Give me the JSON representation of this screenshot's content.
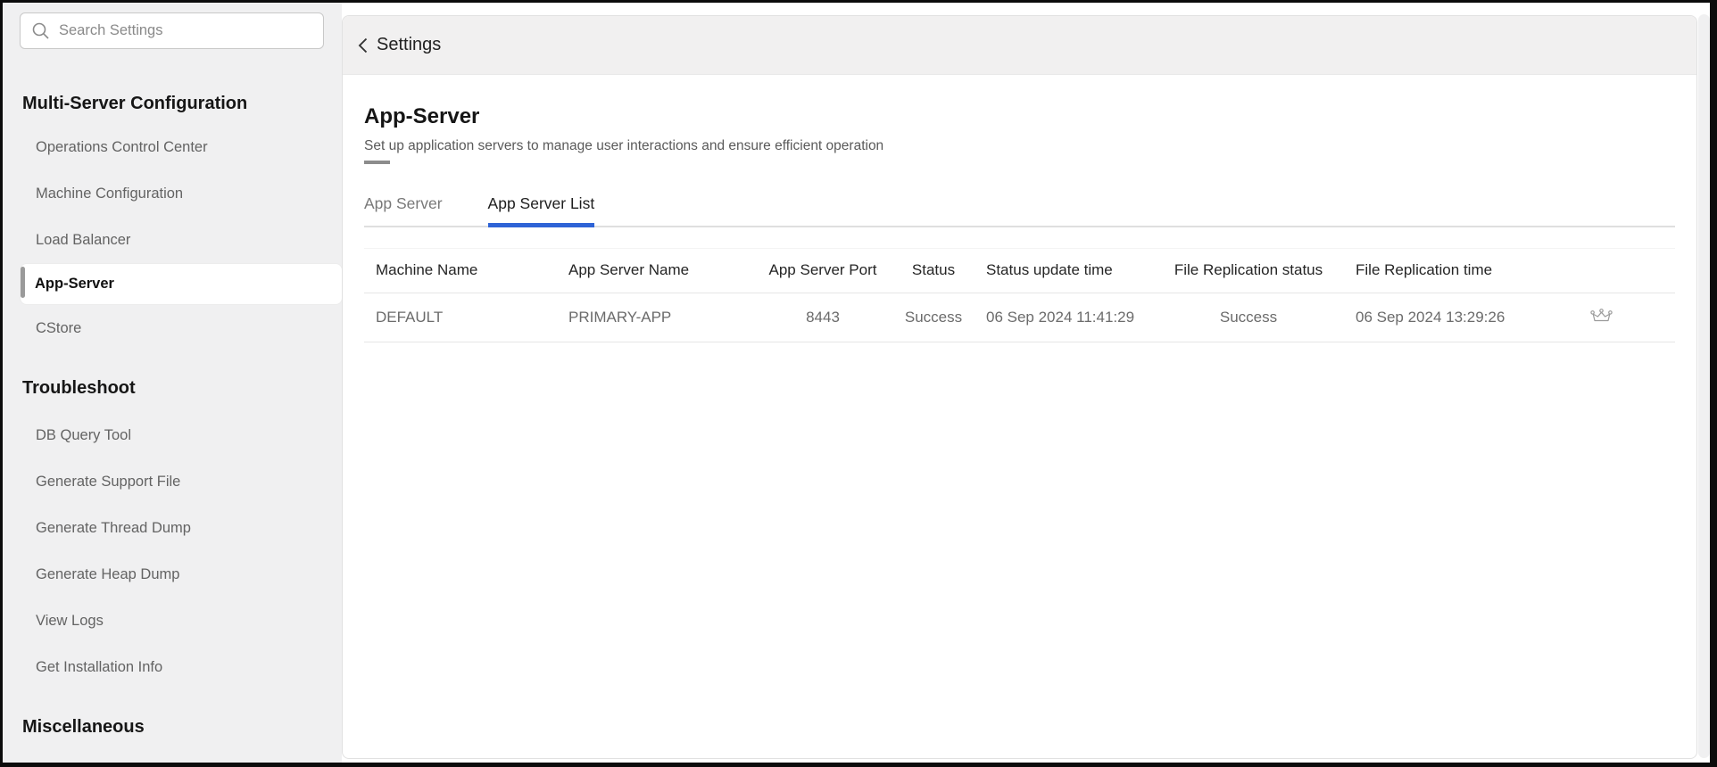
{
  "colors": {
    "accent_blue": "#2e63d6",
    "selected_item_accent": "#9a9a9a",
    "sidebar_background": "#f0f0f1",
    "card_header_background": "#f1f0f0"
  },
  "sidebar": {
    "search": {
      "placeholder": "Search Settings"
    },
    "sections": [
      {
        "title": "Multi-Server Configuration",
        "items": [
          {
            "label": "Operations Control Center",
            "selected": false
          },
          {
            "label": "Machine Configuration",
            "selected": false
          },
          {
            "label": "Load Balancer",
            "selected": false
          },
          {
            "label": "App-Server",
            "selected": true
          },
          {
            "label": "CStore",
            "selected": false
          }
        ]
      },
      {
        "title": "Troubleshoot",
        "items": [
          {
            "label": "DB Query Tool",
            "selected": false
          },
          {
            "label": "Generate Support File",
            "selected": false
          },
          {
            "label": "Generate Thread Dump",
            "selected": false
          },
          {
            "label": "Generate Heap Dump",
            "selected": false
          },
          {
            "label": "View Logs",
            "selected": false
          },
          {
            "label": "Get Installation Info",
            "selected": false
          }
        ]
      },
      {
        "title": "Miscellaneous",
        "items": []
      }
    ]
  },
  "header": {
    "back_label": "Settings"
  },
  "page": {
    "title": "App-Server",
    "subtitle": "Set up application servers to manage user interactions and ensure efficient operation",
    "tabs": [
      {
        "label": "App Server",
        "active": false
      },
      {
        "label": "App Server List",
        "active": true
      }
    ]
  },
  "table": {
    "columns": [
      {
        "key": "machine_name",
        "label": "Machine Name",
        "align": "left"
      },
      {
        "key": "app_server_name",
        "label": "App Server Name",
        "align": "left"
      },
      {
        "key": "app_server_port",
        "label": "App Server Port",
        "align": "center"
      },
      {
        "key": "status",
        "label": "Status",
        "align": "center"
      },
      {
        "key": "status_update_time",
        "label": "Status update time",
        "align": "left"
      },
      {
        "key": "file_replication_status",
        "label": "File Replication status",
        "align": "center"
      },
      {
        "key": "file_replication_time",
        "label": "File Replication time",
        "align": "left"
      },
      {
        "key": "primary_indicator",
        "label": "",
        "align": "center"
      }
    ],
    "rows": [
      {
        "machine_name": "DEFAULT",
        "app_server_name": "PRIMARY-APP",
        "app_server_port": "8443",
        "status": "Success",
        "status_update_time": "06 Sep 2024 11:41:29",
        "file_replication_status": "Success",
        "file_replication_time": "06 Sep 2024 13:29:26",
        "primary_indicator": "crown-icon"
      }
    ]
  }
}
